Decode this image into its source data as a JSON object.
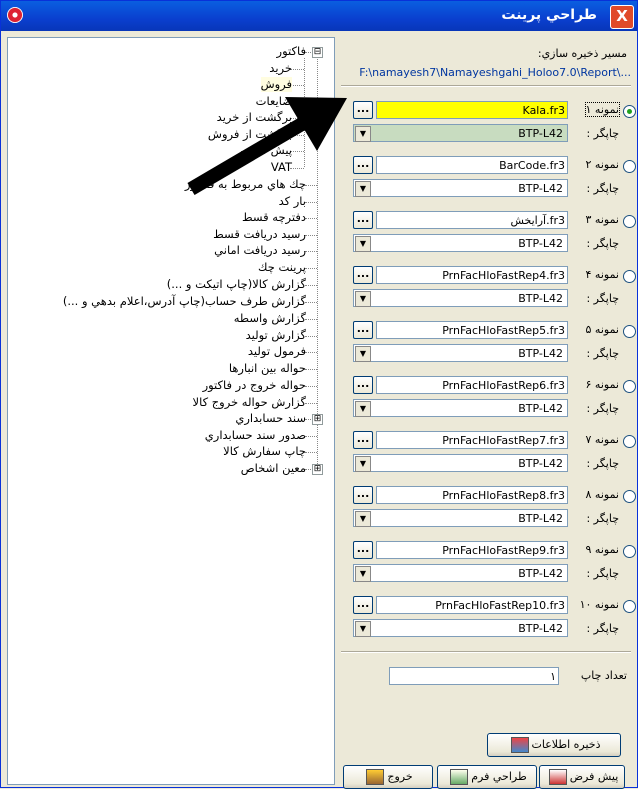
{
  "window": {
    "title": "طراحي پرينت",
    "close_label": "X"
  },
  "tree": {
    "nodes": [
      {
        "label": "فاكتور",
        "expander": "⊟"
      },
      {
        "label": "خريد"
      },
      {
        "label": "فروش",
        "selected": true
      },
      {
        "label": "ضايعات"
      },
      {
        "label": "برگشت از خريد"
      },
      {
        "label": "برگشت از فروش"
      },
      {
        "label": "پيش فاكتور"
      },
      {
        "label": "VAT"
      },
      {
        "label": "چك هاي مربوط به فاكتور"
      },
      {
        "label": "بار كد"
      },
      {
        "label": "دفترچه قسط"
      },
      {
        "label": "رسيد دريافت قسط"
      },
      {
        "label": "رسيد دريافت اماني"
      },
      {
        "label": "پرينت چك"
      },
      {
        "label": "گزارش كالا(چاپ اتيكت و ...)"
      },
      {
        "label": "گزارش طرف حساب(چاپ آدرس،اعلام بدهي و ...)"
      },
      {
        "label": "گزارش واسطه"
      },
      {
        "label": "گزارش توليد"
      },
      {
        "label": "فرمول توليد"
      },
      {
        "label": "حواله بين انبارها"
      },
      {
        "label": "حواله خروج در فاكتور"
      },
      {
        "label": "گزارش حواله خروج كالا"
      },
      {
        "label": "سند حسابداري",
        "expander": "⊞"
      },
      {
        "label": "صدور سند حسابداري"
      },
      {
        "label": "چاپ سفارش كالا"
      },
      {
        "label": "معين اشخاص",
        "expander": "⊞"
      }
    ]
  },
  "settings": {
    "path_label": "مسير ذخيره سازي:",
    "path_value": "F:\\namayesh7\\Namayeshgahi_Holoo7.0\\Report\\...",
    "dots_label": "...",
    "printer_label": "چاپگر :",
    "samples": [
      {
        "label": "نمونه ۱",
        "file": "Kala.fr3",
        "printer": "BTP-L42",
        "checked": true
      },
      {
        "label": "نمونه ۲",
        "file": "BarCode.fr3",
        "printer": "BTP-L42"
      },
      {
        "label": "نمونه ۳",
        "file": "آرايخش.fr3",
        "printer": "BTP-L42"
      },
      {
        "label": "نمونه ۴",
        "file": "PrnFacHloFastRep4.fr3",
        "printer": "BTP-L42"
      },
      {
        "label": "نمونه ۵",
        "file": "PrnFacHloFastRep5.fr3",
        "printer": "BTP-L42"
      },
      {
        "label": "نمونه ۶",
        "file": "PrnFacHloFastRep6.fr3",
        "printer": "BTP-L42"
      },
      {
        "label": "نمونه ۷",
        "file": "PrnFacHloFastRep7.fr3",
        "printer": "BTP-L42"
      },
      {
        "label": "نمونه ۸",
        "file": "PrnFacHloFastRep8.fr3",
        "printer": "BTP-L42"
      },
      {
        "label": "نمونه ۹",
        "file": "PrnFacHloFastRep9.fr3",
        "printer": "BTP-L42"
      },
      {
        "label": "نمونه ۱۰",
        "file": "PrnFacHloFastRep10.fr3",
        "printer": "BTP-L42"
      }
    ],
    "copies_label": "تعداد چاپ",
    "copies_value": "۱"
  },
  "buttons": {
    "save": "ذخيره اطلاعات",
    "default": "پيش فرض",
    "design": "طراحي فرم",
    "exit": "خروج"
  },
  "colors": {
    "title_bar": "#0a3fcf",
    "selected_file": "#ffff00",
    "selected_printer": "#c8dcc0"
  }
}
